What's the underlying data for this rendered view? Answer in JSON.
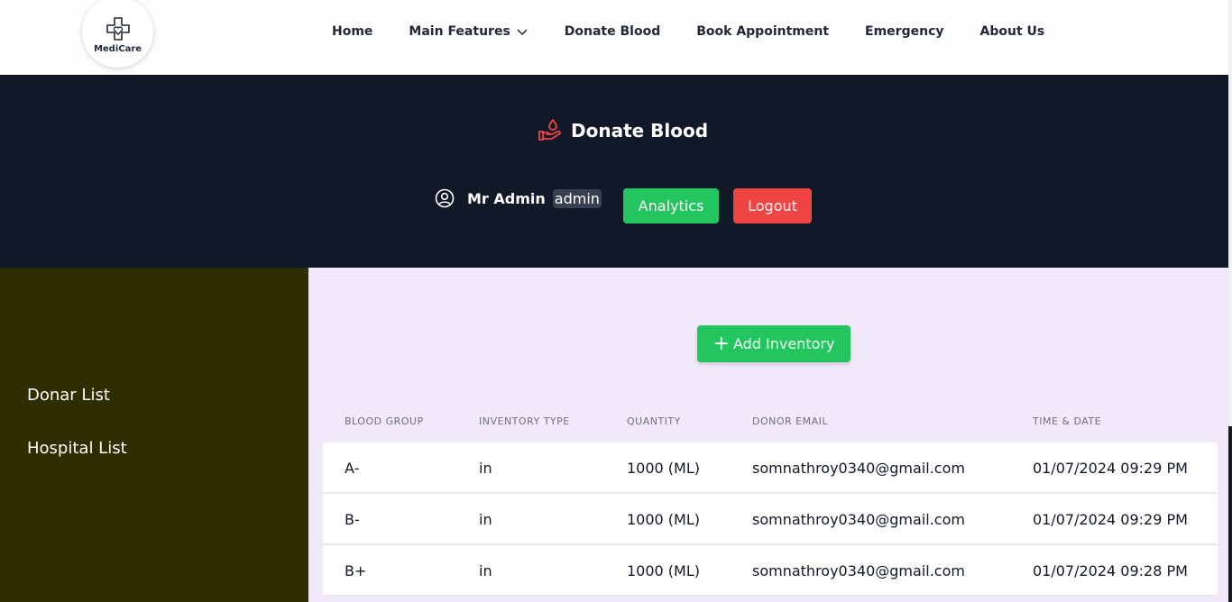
{
  "logo": {
    "text": "MediCare"
  },
  "nav": {
    "items": [
      {
        "label": "Home"
      },
      {
        "label": "Main Features"
      },
      {
        "label": "Donate Blood"
      },
      {
        "label": "Book Appointment"
      },
      {
        "label": "Emergency"
      },
      {
        "label": "About Us"
      }
    ]
  },
  "hero": {
    "title": "Donate Blood",
    "user_name": "Mr Admin",
    "role": "admin",
    "analytics_label": "Analytics",
    "logout_label": "Logout"
  },
  "sidebar": {
    "items": [
      {
        "label": "Donar List"
      },
      {
        "label": "Hospital List"
      }
    ]
  },
  "main": {
    "add_label": "Add Inventory",
    "columns": [
      "Blood Group",
      "Inventory Type",
      "Quantity",
      "Donor Email",
      "Time & Date"
    ],
    "rows": [
      {
        "blood_group": "A-",
        "type": "in",
        "quantity": "1000 (ML)",
        "email": "somnathroy0340@gmail.com",
        "datetime": "01/07/2024 09:29 PM"
      },
      {
        "blood_group": "B-",
        "type": "in",
        "quantity": "1000 (ML)",
        "email": "somnathroy0340@gmail.com",
        "datetime": "01/07/2024 09:29 PM"
      },
      {
        "blood_group": "B+",
        "type": "in",
        "quantity": "1000 (ML)",
        "email": "somnathroy0340@gmail.com",
        "datetime": "01/07/2024 09:28 PM"
      }
    ]
  },
  "colors": {
    "accent_green": "#22c55e",
    "accent_red": "#ef4444",
    "hero_bg": "#111827",
    "sidebar_bg": "#2e2e00",
    "main_bg": "#f1e8fa"
  }
}
